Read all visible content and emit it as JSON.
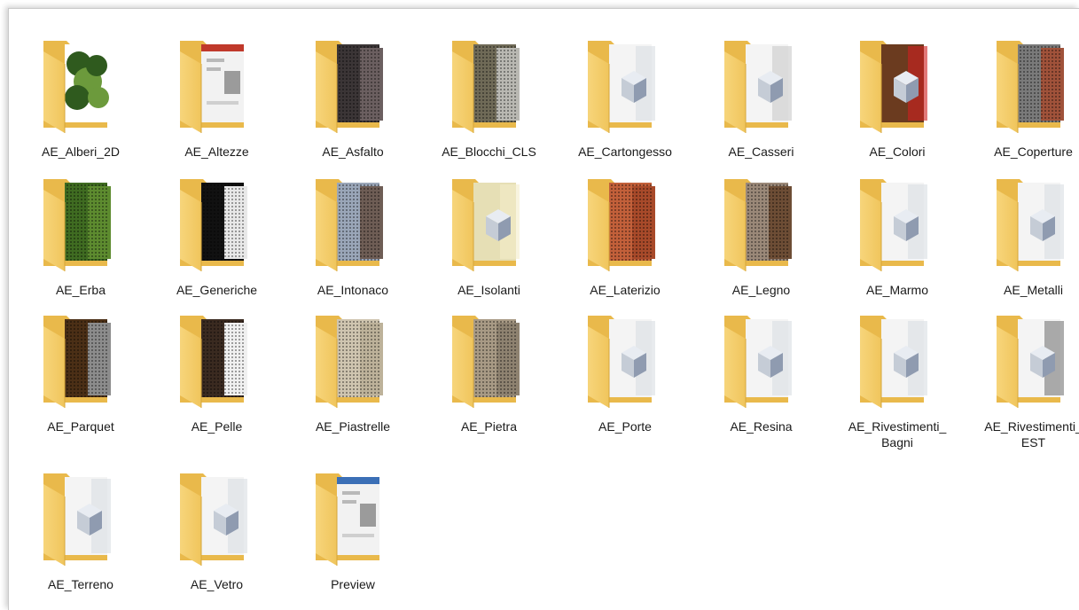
{
  "window": {
    "background": "#ffffff"
  },
  "folders": [
    {
      "label": "AE_Alberi_2D",
      "icon": "folder-icon",
      "thumb": "tree",
      "c1": "#2f5a1e",
      "c2": "#6c9a3c"
    },
    {
      "label": "AE_Altezze",
      "icon": "folder-icon",
      "thumb": "dialog",
      "c1": "#f2f2f2",
      "c2": "#c0392b"
    },
    {
      "label": "AE_Asfalto",
      "icon": "folder-icon",
      "thumb": "solid",
      "c1": "#3b3536",
      "c2": "#6b5f60"
    },
    {
      "label": "AE_Blocchi_CLS",
      "icon": "folder-icon",
      "thumb": "solid",
      "c1": "#6f6a57",
      "c2": "#b9b8b2"
    },
    {
      "label": "AE_Cartongesso",
      "icon": "folder-icon",
      "thumb": "cube",
      "c1": "#f4f4f4",
      "c2": "#d9dde3"
    },
    {
      "label": "AE_Casseri",
      "icon": "folder-icon",
      "thumb": "cube",
      "c1": "#f4f4f4",
      "c2": "#c9c9c9"
    },
    {
      "label": "AE_Colori",
      "icon": "folder-icon",
      "thumb": "cube",
      "c1": "#6b3b1f",
      "c2": "#cf1f1f"
    },
    {
      "label": "AE_Coperture",
      "icon": "folder-icon",
      "thumb": "solid",
      "c1": "#7a7a7a",
      "c2": "#a0523a"
    },
    {
      "label": "AE_Erba",
      "icon": "folder-icon",
      "thumb": "solid",
      "c1": "#3f6b21",
      "c2": "#5d8b2f"
    },
    {
      "label": "AE_Generiche",
      "icon": "folder-icon",
      "thumb": "solid",
      "c1": "#111111",
      "c2": "#e8e8e8"
    },
    {
      "label": "AE_Intonaco",
      "icon": "folder-icon",
      "thumb": "solid",
      "c1": "#9aa6b8",
      "c2": "#6e5d55"
    },
    {
      "label": "AE_Isolanti",
      "icon": "folder-icon",
      "thumb": "cube",
      "c1": "#e6dfb5",
      "c2": "#f3edc9"
    },
    {
      "label": "AE_Laterizio",
      "icon": "folder-icon",
      "thumb": "solid",
      "c1": "#c2603a",
      "c2": "#a84a2a"
    },
    {
      "label": "AE_Legno",
      "icon": "folder-icon",
      "thumb": "solid",
      "c1": "#9a8878",
      "c2": "#6d4d35"
    },
    {
      "label": "AE_Marmo",
      "icon": "folder-icon",
      "thumb": "cube",
      "c1": "#f4f4f4",
      "c2": "#d9dde3"
    },
    {
      "label": "AE_Metalli",
      "icon": "folder-icon",
      "thumb": "cube",
      "c1": "#f4f4f4",
      "c2": "#d9dde3"
    },
    {
      "label": "AE_Parquet",
      "icon": "folder-icon",
      "thumb": "solid",
      "c1": "#4b2f16",
      "c2": "#8c8c8c"
    },
    {
      "label": "AE_Pelle",
      "icon": "folder-icon",
      "thumb": "solid",
      "c1": "#3a2a20",
      "c2": "#f0f0f0"
    },
    {
      "label": "AE_Piastrelle",
      "icon": "folder-icon",
      "thumb": "solid",
      "c1": "#cfc5b0",
      "c2": "#bdb29a"
    },
    {
      "label": "AE_Pietra",
      "icon": "folder-icon",
      "thumb": "solid",
      "c1": "#a89a85",
      "c2": "#8e8270"
    },
    {
      "label": "AE_Porte",
      "icon": "folder-icon",
      "thumb": "cube",
      "c1": "#f4f4f4",
      "c2": "#d9dde3"
    },
    {
      "label": "AE_Resina",
      "icon": "folder-icon",
      "thumb": "cube",
      "c1": "#f4f4f4",
      "c2": "#d9dde3"
    },
    {
      "label": "AE_Rivestimenti_\nBagni",
      "icon": "folder-icon",
      "thumb": "cube",
      "c1": "#f4f4f4",
      "c2": "#d9dde3"
    },
    {
      "label": "AE_Rivestimenti_\nEST",
      "icon": "folder-icon",
      "thumb": "cube",
      "c1": "#f4f4f4",
      "c2": "#777777"
    },
    {
      "label": "AE_Terreno",
      "icon": "folder-icon",
      "thumb": "cube",
      "c1": "#f4f4f4",
      "c2": "#d9dde3"
    },
    {
      "label": "AE_Vetro",
      "icon": "folder-icon",
      "thumb": "cube",
      "c1": "#f4f4f4",
      "c2": "#d9dde3"
    },
    {
      "label": "Preview",
      "icon": "folder-icon",
      "thumb": "dialog",
      "c1": "#f2f2f2",
      "c2": "#3b6fb6"
    }
  ]
}
